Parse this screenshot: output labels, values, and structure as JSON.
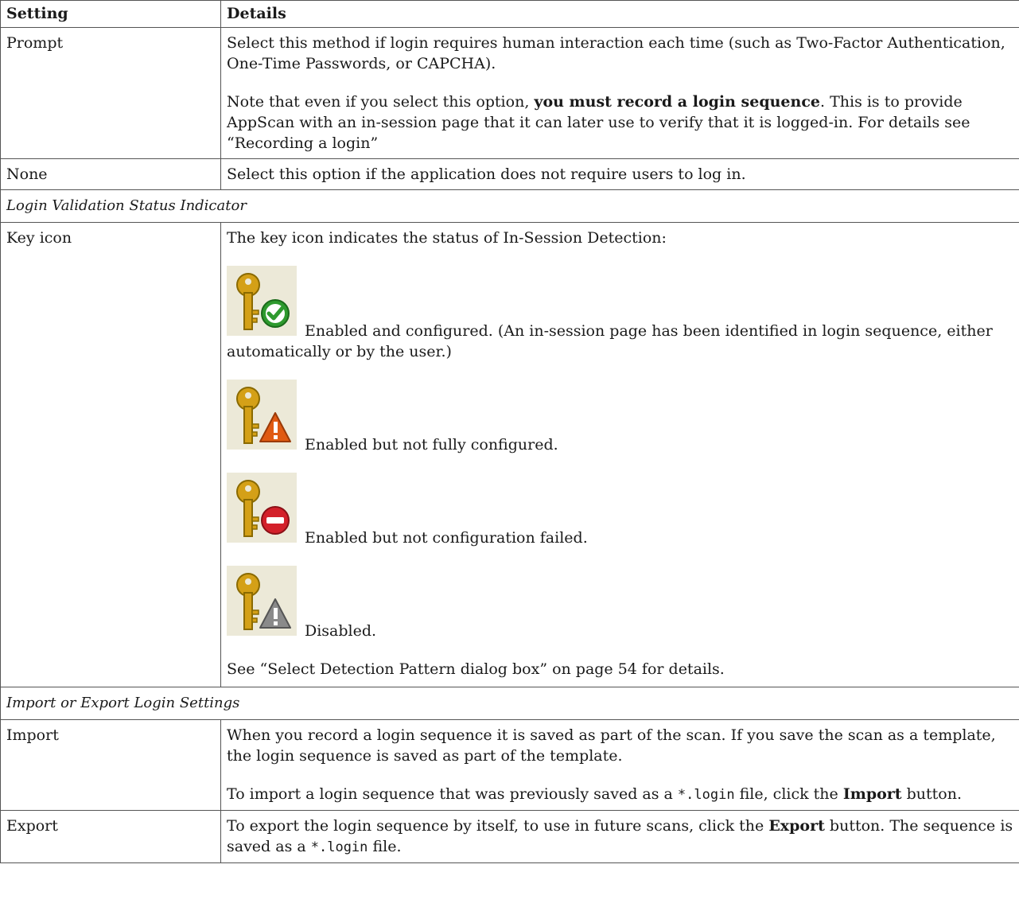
{
  "table": {
    "header": {
      "setting": "Setting",
      "details": "Details"
    },
    "prompt": {
      "setting": "Prompt",
      "p1": "Select this method if login requires human interaction each time (such as Two-Factor Authentication, One-Time Passwords, or CAPCHA).",
      "p2_before": "Note that even if you select this option, ",
      "p2_bold": "you must record a login sequence",
      "p2_after": ". This is to provide AppScan with an in-session page that it can later use to verify that it is logged-in. For details see “Recording a login”"
    },
    "none": {
      "setting": "None",
      "details": "Select this option if the application does not require users to log in."
    },
    "section_login_validation": "Login Validation Status Indicator",
    "key_icon": {
      "setting": "Key icon",
      "intro": "The key icon indicates the status of In-Session Detection:",
      "states": [
        {
          "icon": "key-check-icon",
          "label": "Enabled and configured. (An in-session page has been identified in login sequence, either automatically or by the user.)"
        },
        {
          "icon": "key-warning-icon",
          "label": "Enabled but not fully configured."
        },
        {
          "icon": "key-error-icon",
          "label": "Enabled but not configuration failed."
        },
        {
          "icon": "key-disabled-icon",
          "label": "Disabled."
        }
      ],
      "see_also": "See “Select Detection Pattern dialog box” on page 54 for details."
    },
    "section_import_export": "Import or Export Login Settings",
    "import": {
      "setting": "Import",
      "p1": "When you record a login sequence it is saved as part of the scan. If you save the scan as a template, the login sequence is saved as part of the template.",
      "p2_before": "To import a login sequence that was previously saved as a ",
      "p2_code": "*.login",
      "p2_mid": " file, click the ",
      "p2_bold": "Import",
      "p2_after": " button."
    },
    "export": {
      "setting": "Export",
      "p_before": "To export the login sequence by itself, to use in future scans, click the ",
      "p_bold": "Export",
      "p_mid": " button. The sequence is saved as a ",
      "p_code": "*.login",
      "p_after": " file."
    }
  },
  "colors": {
    "key_gold": "#d4a017",
    "check_green": "#2e9a2e",
    "warning_orange": "#e05a12",
    "error_red": "#d3202a",
    "disabled_gray": "#8a8a8a",
    "icon_bg": "#ece9d8"
  }
}
